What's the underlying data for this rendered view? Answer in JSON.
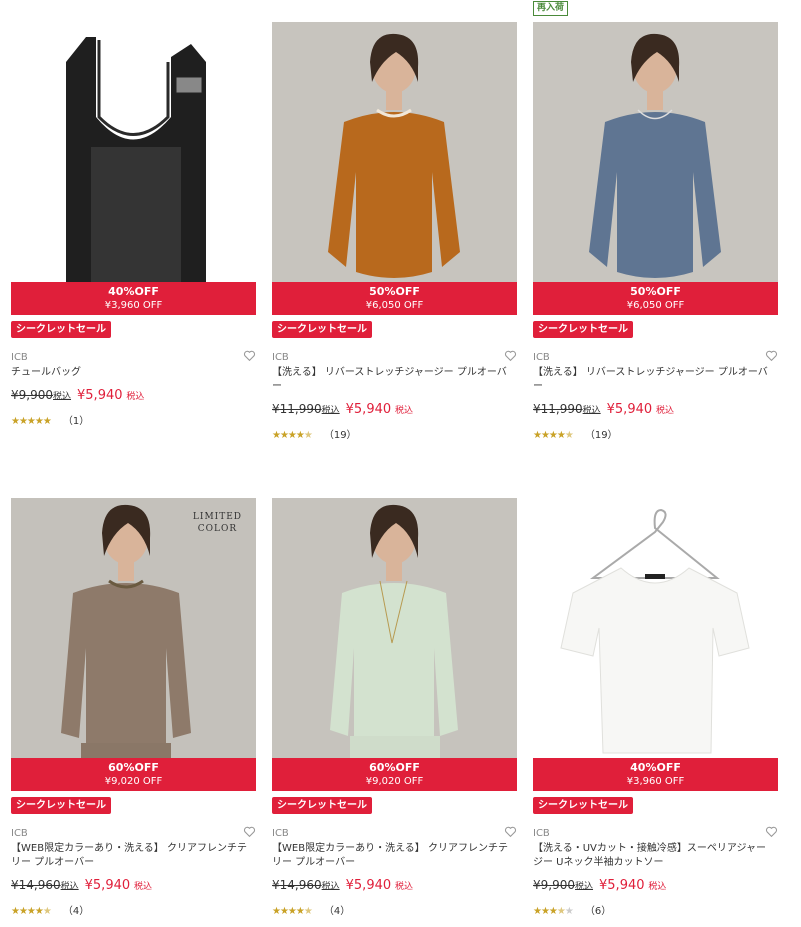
{
  "restock_label": "再入荷",
  "secret_sale_label": "シークレットセール",
  "tax_label": "税込",
  "colors": {
    "sale_red": "#e01f3a",
    "star": "#c9a227",
    "restock_green": "#4a8a3a"
  },
  "products": [
    {
      "brand": "ICB",
      "name": "チュールバッグ",
      "discount_pct": "40%OFF",
      "discount_amt": "¥3,960 OFF",
      "old_price": "¥9,900",
      "new_price": "¥5,940",
      "rating": 5,
      "review_count": "（1）",
      "image_overlay": "",
      "icon": "bag"
    },
    {
      "brand": "ICB",
      "name": "【洗える】 リバーストレッチジャージー プルオーバー",
      "discount_pct": "50%OFF",
      "discount_amt": "¥6,050 OFF",
      "old_price": "¥11,990",
      "new_price": "¥5,940",
      "rating": 4.5,
      "review_count": "（19）",
      "image_overlay": "",
      "icon": "orange-top"
    },
    {
      "brand": "ICB",
      "name": "【洗える】 リバーストレッチジャージー プルオーバー",
      "discount_pct": "50%OFF",
      "discount_amt": "¥6,050 OFF",
      "old_price": "¥11,990",
      "new_price": "¥5,940",
      "rating": 4.5,
      "review_count": "（19）",
      "image_overlay": "",
      "icon": "blue-top"
    },
    {
      "brand": "ICB",
      "name": "【WEB限定カラーあり・洗える】 クリアフレンチテリー プルオーバー",
      "discount_pct": "60%OFF",
      "discount_amt": "¥9,020 OFF",
      "old_price": "¥14,960",
      "new_price": "¥5,940",
      "rating": 4.5,
      "review_count": "（4）",
      "image_overlay": "LIMITED\nCOLOR",
      "icon": "taupe-top"
    },
    {
      "brand": "ICB",
      "name": "【WEB限定カラーあり・洗える】 クリアフレンチテリー プルオーバー",
      "discount_pct": "60%OFF",
      "discount_amt": "¥9,020 OFF",
      "old_price": "¥14,960",
      "new_price": "¥5,940",
      "rating": 4.5,
      "review_count": "（4）",
      "image_overlay": "",
      "icon": "mint-top"
    },
    {
      "brand": "ICB",
      "name": "【洗える・UVカット・接触冷感】スーペリアジャージー Uネック半袖カットソー",
      "discount_pct": "40%OFF",
      "discount_amt": "¥3,960 OFF",
      "old_price": "¥9,900",
      "new_price": "¥5,940",
      "rating": 3.5,
      "review_count": "（6）",
      "image_overlay": "",
      "icon": "white-tee"
    }
  ]
}
